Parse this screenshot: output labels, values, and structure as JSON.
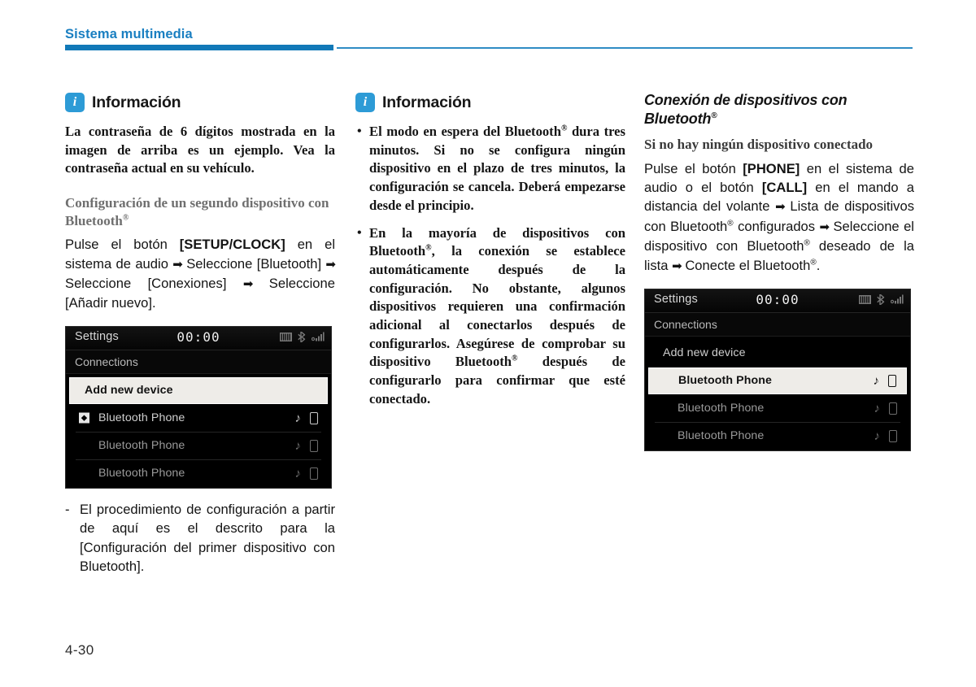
{
  "header": {
    "title": "Sistema multimedia",
    "accent_color": "#1179b8"
  },
  "folio": "4-30",
  "col1": {
    "info": {
      "icon": "i",
      "title": "Información",
      "body": "La contraseña de 6 dígitos mostrada en la imagen de arriba es un ejemplo. Vea la contraseña actual en su vehículo."
    },
    "subheading": "Configuración de un segundo dispositivo con Bluetooth®",
    "instruction_parts": {
      "p1": "Pulse el botón ",
      "b1": "[SETUP/CLOCK]",
      "p2": " en el sistema de audio ",
      "a1": "➡",
      "p3": " Seleccione [Bluetooth] ",
      "a2": "➡",
      "p4": " Seleccione [Conexiones] ",
      "a3": "➡",
      "p5": " Seleccione [Añadir nuevo]."
    },
    "screen": {
      "status_title": "Settings",
      "clock": "00:00",
      "breadcrumb": "Connections",
      "rows": [
        {
          "label": "Add new device",
          "selected": true,
          "dim": false,
          "bt_icon": false,
          "has_icons": false
        },
        {
          "label": "Bluetooth Phone",
          "selected": false,
          "dim": false,
          "bt_icon": true,
          "has_icons": true
        },
        {
          "label": "Bluetooth Phone",
          "selected": false,
          "dim": true,
          "bt_icon": false,
          "has_icons": true
        },
        {
          "label": "Bluetooth Phone",
          "selected": false,
          "dim": true,
          "bt_icon": false,
          "has_icons": true
        }
      ]
    },
    "note": {
      "dash": "-",
      "text": "El procedimiento de configuración a partir de aquí es el descrito para la [Configuración del primer dispositivo con Bluetooth]."
    }
  },
  "col2": {
    "info": {
      "icon": "i",
      "title": "Información",
      "bullets": [
        "El modo en espera del Bluetooth® dura tres minutos. Si no se configura ningún dispositivo en el plazo de tres minutos, la configuración se cancela. Deberá empezarse desde el principio.",
        "En la mayoría de dispositivos con Bluetooth®, la conexión se establece automáticamente después de la configuración. No obstante, algunos dispositivos requieren una confirmación adicional al conectarlos después de configurarlos. Asegúrese de comprobar su dispositivo Bluetooth® después de configurarlo para confirmar que esté conectado."
      ]
    }
  },
  "col3": {
    "section_heading": "Conexión de dispositivos con Bluetooth®",
    "subheading": "Si no hay ningún dispositivo conectado",
    "instruction_parts": {
      "p1": "Pulse el botón ",
      "b1": "[PHONE]",
      "p2": " en el sistema de audio o el botón ",
      "b2": "[CALL]",
      "p3": " en el mando a distancia del volante ",
      "a1": "➡",
      "p4": " Lista de dispositivos con Bluetooth® configurados ",
      "a2": "➡",
      "p5": " Seleccione el dispositivo con Bluetooth® deseado de la lista ",
      "a3": "➡",
      "p6": " Conecte el Bluetooth®."
    },
    "screen": {
      "status_title": "Settings",
      "clock": "00:00",
      "breadcrumb": "Connections",
      "rows": [
        {
          "label": "Add new device",
          "selected": false,
          "dim": false,
          "bt_icon": false,
          "has_icons": false
        },
        {
          "label": "Bluetooth Phone",
          "selected": true,
          "dim": false,
          "bt_icon": false,
          "has_icons": true
        },
        {
          "label": "Bluetooth Phone",
          "selected": false,
          "dim": true,
          "bt_icon": false,
          "has_icons": true
        },
        {
          "label": "Bluetooth Phone",
          "selected": false,
          "dim": true,
          "bt_icon": false,
          "has_icons": true
        }
      ]
    }
  }
}
